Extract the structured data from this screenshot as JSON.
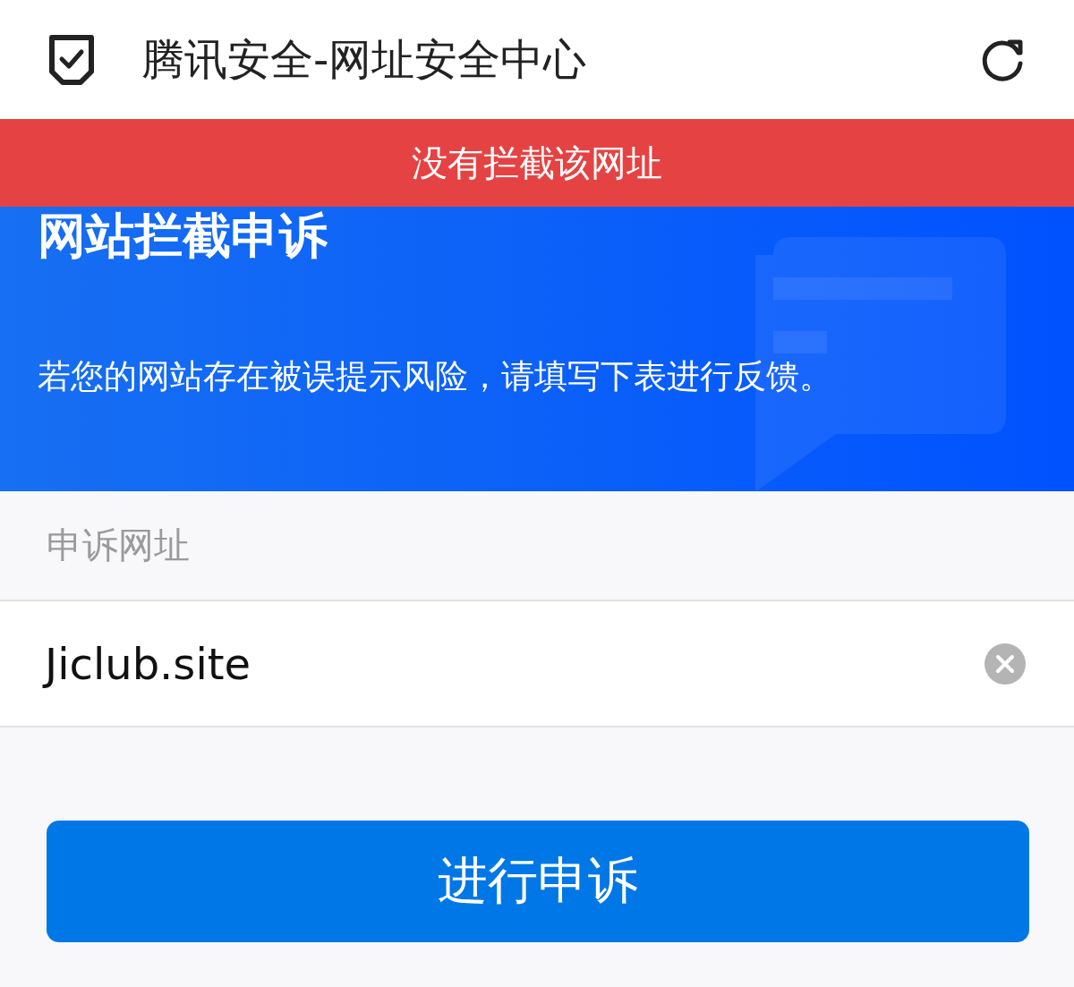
{
  "header": {
    "title": "腾讯安全-网址安全中心"
  },
  "banner": {
    "text": "没有拦截该网址"
  },
  "hero": {
    "title": "网站拦截申诉",
    "description": "若您的网站存在被误提示风险，请填写下表进行反馈。"
  },
  "form": {
    "label": "申诉网址",
    "url_field": {
      "value": "Jiclub.site"
    }
  },
  "submit_button": {
    "label": "进行申诉"
  }
}
